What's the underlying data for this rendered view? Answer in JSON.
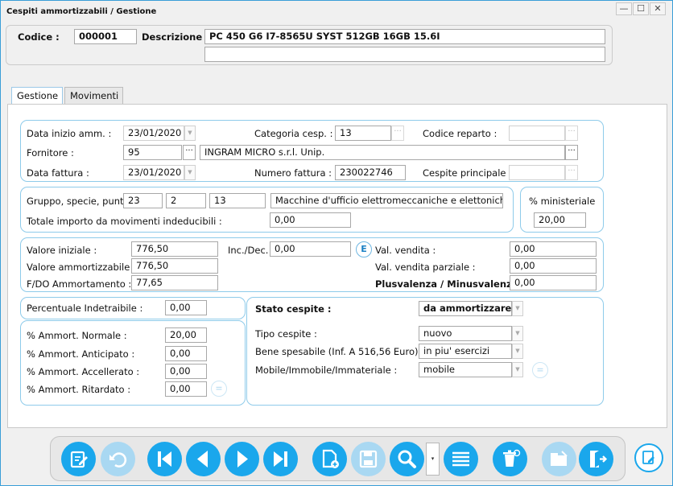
{
  "window": {
    "title": "Cespiti ammortizzabili / Gestione",
    "minimize": "—",
    "maximize": "☐",
    "close": "✕"
  },
  "header": {
    "codice_label": "Codice :",
    "codice_value": "000001",
    "descrizione_label": "Descrizione :",
    "descrizione_value": "PC 450 G6 I7-8565U SYST 512GB 16GB 15.6I",
    "descrizione_value2": ""
  },
  "tabs": [
    {
      "label": "Gestione",
      "active": true
    },
    {
      "label": "Movimenti",
      "active": false
    }
  ],
  "section1": {
    "data_inizio_label": "Data inizio amm. :",
    "data_inizio_value": "23/01/2020",
    "categoria_label": "Categoria cesp. :",
    "categoria_value": "13",
    "codice_reparto_label": "Codice reparto :",
    "codice_reparto_value": "",
    "fornitore_label": "Fornitore :",
    "fornitore_code": "95",
    "fornitore_name": "INGRAM MICRO s.r.l. Unip.",
    "data_fattura_label": "Data fattura :",
    "data_fattura_value": "23/01/2020",
    "numero_fattura_label": "Numero fattura :",
    "numero_fattura_value": "230022746",
    "cespite_principale_label": "Cespite principale :",
    "cespite_principale_value": ""
  },
  "section2": {
    "gruppo_label": "Gruppo, specie, punto",
    "gruppo_value": "23",
    "specie_value": "2",
    "punto_value": "13",
    "descrizione_value": "Macchine d'ufficio elettromeccaniche e elettoniche",
    "totale_label": "Totale importo da movimenti indeducibili :",
    "totale_value": "0,00",
    "ministeriale_label": "% ministeriale",
    "ministeriale_value": "20,00"
  },
  "section3": {
    "valore_iniziale_label": "Valore iniziale :",
    "valore_iniziale_value": "776,50",
    "inc_dec_label": "Inc./Dec.",
    "inc_dec_value": "0,00",
    "e_button": "E",
    "val_vendita_label": "Val. vendita :",
    "val_vendita_value": "0,00",
    "valore_amm_label": "Valore ammortizzabile :",
    "valore_amm_value": "776,50",
    "val_vendita_parziale_label": "Val. vendita parziale :",
    "val_vendita_parziale_value": "0,00",
    "fdo_label": "F/DO Ammortamento :",
    "fdo_value": "77,65",
    "plusvalenza_label": "Plusvalenza / Minusvalenza :",
    "plusvalenza_value": "0,00"
  },
  "section4": {
    "perc_indetraibile_label": "Percentuale Indetraibile :",
    "perc_indetraibile_value": "0,00",
    "normale_label": "% Ammort. Normale :",
    "normale_value": "20,00",
    "anticipato_label": "% Ammort. Anticipato :",
    "anticipato_value": "0,00",
    "accellerato_label": "% Ammort. Accellerato :",
    "accellerato_value": "0,00",
    "ritardato_label": "% Ammort. Ritardato :",
    "ritardato_value": "0,00",
    "eq_button": "="
  },
  "section5": {
    "stato_label": "Stato cespite :",
    "stato_value": "da ammortizzare",
    "tipo_label": "Tipo cespite :",
    "tipo_value": "nuovo",
    "bene_label": "Bene spesabile (Inf. A 516,56 Euro) :",
    "bene_value": "in piu' esercizi",
    "mobile_label": "Mobile/Immobile/Immateriale :",
    "mobile_value": "mobile",
    "eq_button": "="
  },
  "toolbar": {
    "accent": "#1aa7ec",
    "disabled": "#a9d8f2",
    "buttons": [
      "edit-icon",
      "undo-icon",
      "first-icon",
      "previous-icon",
      "next-icon",
      "last-icon",
      "new-document-icon",
      "save-icon",
      "search-icon",
      "list-icon",
      "delete-icon",
      "archive-icon",
      "exit-icon"
    ],
    "search_dropdown": "▾"
  }
}
